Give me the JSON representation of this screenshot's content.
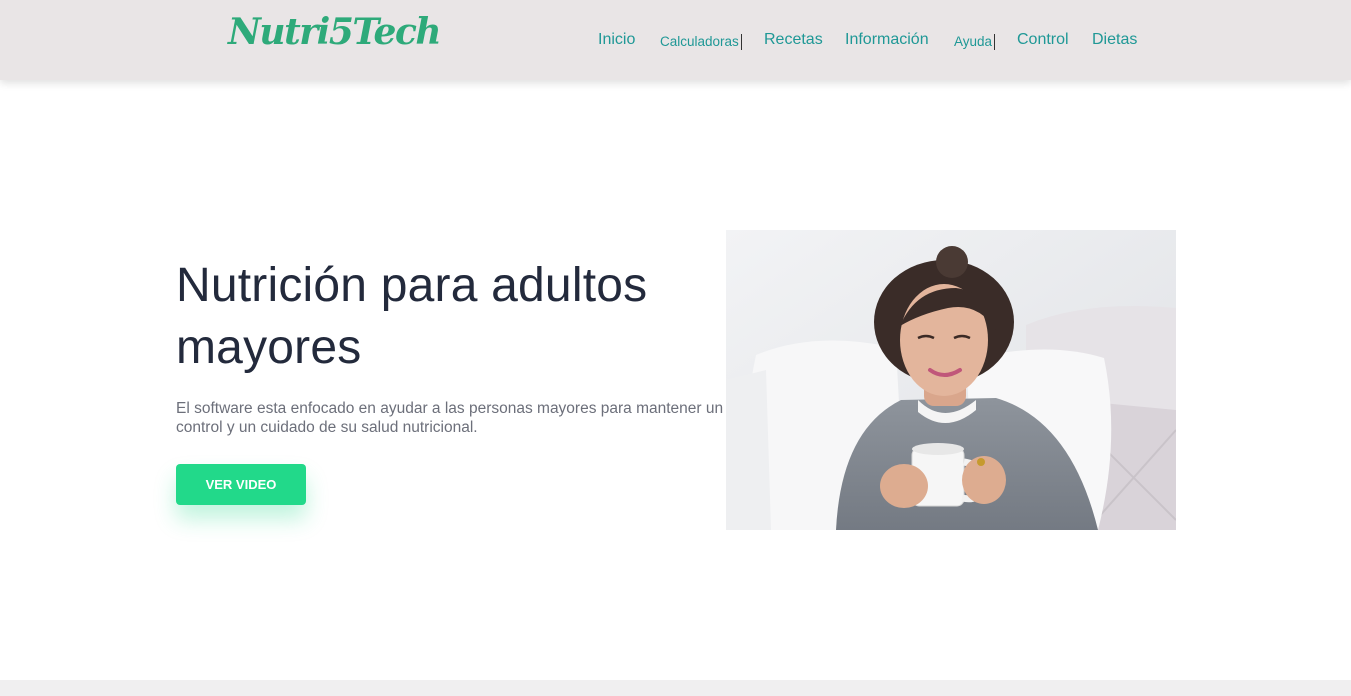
{
  "brand": {
    "name": "Nutri5Tech",
    "color": "#2eaa7a"
  },
  "nav": {
    "links": [
      {
        "label": "Inicio"
      },
      {
        "label": "Calculadoras"
      },
      {
        "label": "Recetas"
      },
      {
        "label": "Información"
      },
      {
        "label": "Ayuda"
      },
      {
        "label": "Control"
      },
      {
        "label": "Dietas"
      }
    ],
    "link_color": "#1f9896",
    "background": "#e9e5e6"
  },
  "hero": {
    "title": "Nutrición para adultos mayores",
    "description": "El software esta enfocado en ayudar a las personas mayores para mantener un control y un cuidado de su salud nutricional.",
    "cta_label": "VER VIDEO",
    "cta_color": "#22d98a",
    "image": {
      "icon": "photo-elderly-woman-holding-cup"
    }
  }
}
